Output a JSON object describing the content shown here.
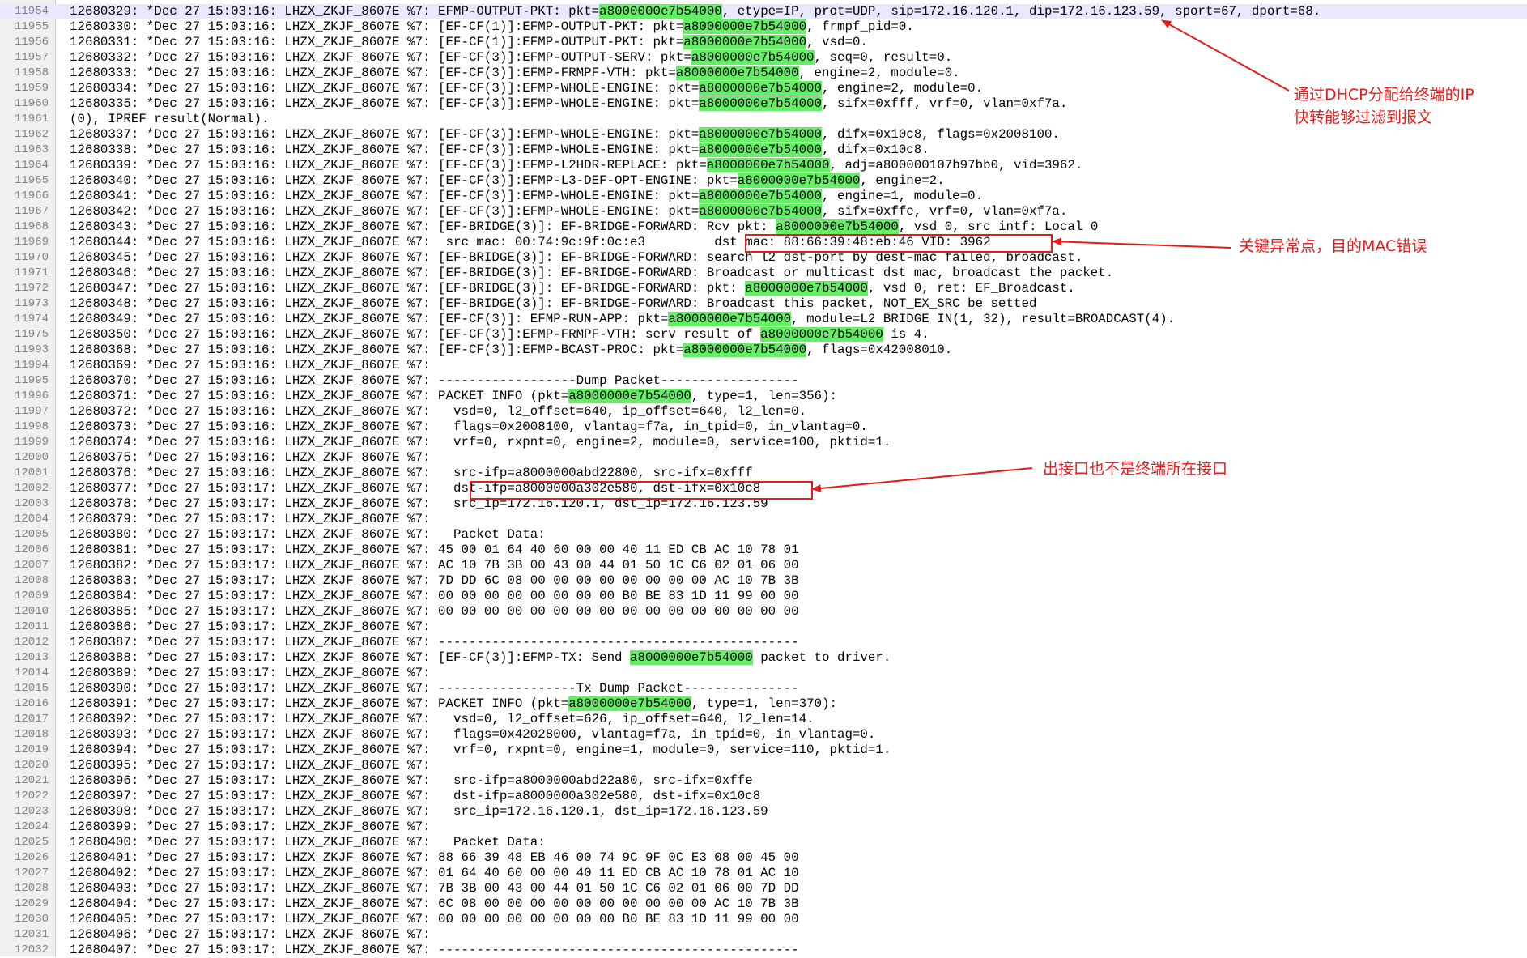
{
  "highlight_token": "a8000000e7b54000",
  "lines": [
    {
      "n": "11954",
      "t": "12680329: *Dec 27 15:03:16: LHZX_ZKJF_8607E %7: EFMP-OUTPUT-PKT: pkt=a8000000e7b54000, etype=IP, prot=UDP, sip=172.16.120.1, dip=172.16.123.59, sport=67, dport=68."
    },
    {
      "n": "11955",
      "t": "12680330: *Dec 27 15:03:16: LHZX_ZKJF_8607E %7: [EF-CF(1)]:EFMP-OUTPUT-PKT: pkt=a8000000e7b54000, frmpf_pid=0."
    },
    {
      "n": "11956",
      "t": "12680331: *Dec 27 15:03:16: LHZX_ZKJF_8607E %7: [EF-CF(1)]:EFMP-OUTPUT-PKT: pkt=a8000000e7b54000, vsd=0."
    },
    {
      "n": "11957",
      "t": "12680332: *Dec 27 15:03:16: LHZX_ZKJF_8607E %7: [EF-CF(3)]:EFMP-OUTPUT-SERV: pkt=a8000000e7b54000, seq=0, result=0."
    },
    {
      "n": "11958",
      "t": "12680333: *Dec 27 15:03:16: LHZX_ZKJF_8607E %7: [EF-CF(3)]:EFMP-FRMPF-VTH: pkt=a8000000e7b54000, engine=2, module=0."
    },
    {
      "n": "11959",
      "t": "12680334: *Dec 27 15:03:16: LHZX_ZKJF_8607E %7: [EF-CF(3)]:EFMP-WHOLE-ENGINE: pkt=a8000000e7b54000, engine=2, module=0."
    },
    {
      "n": "11960",
      "t": "12680335: *Dec 27 15:03:16: LHZX_ZKJF_8607E %7: [EF-CF(3)]:EFMP-WHOLE-ENGINE: pkt=a8000000e7b54000, sifx=0xfff, vrf=0, vlan=0xf7a."
    },
    {
      "n": "11961",
      "t": "(0), IPREF result(Normal)."
    },
    {
      "n": "11962",
      "t": "12680337: *Dec 27 15:03:16: LHZX_ZKJF_8607E %7: [EF-CF(3)]:EFMP-WHOLE-ENGINE: pkt=a8000000e7b54000, difx=0x10c8, flags=0x2008100."
    },
    {
      "n": "11963",
      "t": "12680338: *Dec 27 15:03:16: LHZX_ZKJF_8607E %7: [EF-CF(3)]:EFMP-WHOLE-ENGINE: pkt=a8000000e7b54000, difx=0x10c8."
    },
    {
      "n": "11964",
      "t": "12680339: *Dec 27 15:03:16: LHZX_ZKJF_8607E %7: [EF-CF(3)]:EFMP-L2HDR-REPLACE: pkt=a8000000e7b54000, adj=a800000107b97bb0, vid=3962."
    },
    {
      "n": "11965",
      "t": "12680340: *Dec 27 15:03:16: LHZX_ZKJF_8607E %7: [EF-CF(3)]:EFMP-L3-DEF-OPT-ENGINE: pkt=a8000000e7b54000, engine=2."
    },
    {
      "n": "11966",
      "t": "12680341: *Dec 27 15:03:16: LHZX_ZKJF_8607E %7: [EF-CF(3)]:EFMP-WHOLE-ENGINE: pkt=a8000000e7b54000, engine=1, module=0."
    },
    {
      "n": "11967",
      "t": "12680342: *Dec 27 15:03:16: LHZX_ZKJF_8607E %7: [EF-CF(3)]:EFMP-WHOLE-ENGINE: pkt=a8000000e7b54000, sifx=0xffe, vrf=0, vlan=0xf7a."
    },
    {
      "n": "11968",
      "t": "12680343: *Dec 27 15:03:16: LHZX_ZKJF_8607E %7: [EF-BRIDGE(3)]: EF-BRIDGE-FORWARD: Rcv pkt: a8000000e7b54000, vsd 0, src intf: Local 0"
    },
    {
      "n": "11969",
      "t": "12680344: *Dec 27 15:03:16: LHZX_ZKJF_8607E %7:  src mac: 00:74:9c:9f:0c:e3         dst mac: 88:66:39:48:eb:46 VID: 3962"
    },
    {
      "n": "11970",
      "t": "12680345: *Dec 27 15:03:16: LHZX_ZKJF_8607E %7: [EF-BRIDGE(3)]: EF-BRIDGE-FORWARD: search l2 dst-port by dest-mac failed, broadcast."
    },
    {
      "n": "11971",
      "t": "12680346: *Dec 27 15:03:16: LHZX_ZKJF_8607E %7: [EF-BRIDGE(3)]: EF-BRIDGE-FORWARD: Broadcast or multicast dst mac, broadcast the packet."
    },
    {
      "n": "11972",
      "t": "12680347: *Dec 27 15:03:16: LHZX_ZKJF_8607E %7: [EF-BRIDGE(3)]: EF-BRIDGE-FORWARD: pkt: a8000000e7b54000, vsd 0, ret: EF_Broadcast."
    },
    {
      "n": "11973",
      "t": "12680348: *Dec 27 15:03:16: LHZX_ZKJF_8607E %7: [EF-BRIDGE(3)]: EF-BRIDGE-FORWARD: Broadcast this packet, NOT_EX_SRC be setted"
    },
    {
      "n": "11974",
      "t": "12680349: *Dec 27 15:03:16: LHZX_ZKJF_8607E %7: [EF-CF(3)]: EFMP-RUN-APP: pkt=a8000000e7b54000, module=L2 BRIDGE IN(1, 32), result=BROADCAST(4)."
    },
    {
      "n": "11975",
      "t": "12680350: *Dec 27 15:03:16: LHZX_ZKJF_8607E %7: [EF-CF(3)]:EFMP-FRMPF-VTH: serv result of a8000000e7b54000 is 4."
    },
    {
      "n": "11993",
      "t": "12680368: *Dec 27 15:03:16: LHZX_ZKJF_8607E %7: [EF-CF(3)]:EFMP-BCAST-PROC: pkt=a8000000e7b54000, flags=0x42008010."
    },
    {
      "n": "11994",
      "t": "12680369: *Dec 27 15:03:16: LHZX_ZKJF_8607E %7:"
    },
    {
      "n": "11995",
      "t": "12680370: *Dec 27 15:03:16: LHZX_ZKJF_8607E %7: ------------------Dump Packet------------------"
    },
    {
      "n": "11996",
      "t": "12680371: *Dec 27 15:03:16: LHZX_ZKJF_8607E %7: PACKET INFO (pkt=a8000000e7b54000, type=1, len=356):"
    },
    {
      "n": "11997",
      "t": "12680372: *Dec 27 15:03:16: LHZX_ZKJF_8607E %7:   vsd=0, l2_offset=640, ip_offset=640, l2_len=0."
    },
    {
      "n": "11998",
      "t": "12680373: *Dec 27 15:03:16: LHZX_ZKJF_8607E %7:   flags=0x2008100, vlantag=f7a, in_tpid=0, in_vlantag=0."
    },
    {
      "n": "11999",
      "t": "12680374: *Dec 27 15:03:16: LHZX_ZKJF_8607E %7:   vrf=0, rxpnt=0, engine=2, module=0, service=100, pktid=1."
    },
    {
      "n": "12000",
      "t": "12680375: *Dec 27 15:03:16: LHZX_ZKJF_8607E %7:"
    },
    {
      "n": "12001",
      "t": "12680376: *Dec 27 15:03:16: LHZX_ZKJF_8607E %7:   src-ifp=a8000000abd22800, src-ifx=0xfff"
    },
    {
      "n": "12002",
      "t": "12680377: *Dec 27 15:03:17: LHZX_ZKJF_8607E %7:   dst-ifp=a8000000a302e580, dst-ifx=0x10c8"
    },
    {
      "n": "12003",
      "t": "12680378: *Dec 27 15:03:17: LHZX_ZKJF_8607E %7:   src_ip=172.16.120.1, dst_ip=172.16.123.59"
    },
    {
      "n": "12004",
      "t": "12680379: *Dec 27 15:03:17: LHZX_ZKJF_8607E %7:"
    },
    {
      "n": "12005",
      "t": "12680380: *Dec 27 15:03:17: LHZX_ZKJF_8607E %7:   Packet Data:"
    },
    {
      "n": "12006",
      "t": "12680381: *Dec 27 15:03:17: LHZX_ZKJF_8607E %7: 45 00 01 64 40 60 00 00 40 11 ED CB AC 10 78 01"
    },
    {
      "n": "12007",
      "t": "12680382: *Dec 27 15:03:17: LHZX_ZKJF_8607E %7: AC 10 7B 3B 00 43 00 44 01 50 1C C6 02 01 06 00"
    },
    {
      "n": "12008",
      "t": "12680383: *Dec 27 15:03:17: LHZX_ZKJF_8607E %7: 7D DD 6C 08 00 00 00 00 00 00 00 00 AC 10 7B 3B"
    },
    {
      "n": "12009",
      "t": "12680384: *Dec 27 15:03:17: LHZX_ZKJF_8607E %7: 00 00 00 00 00 00 00 00 B0 BE 83 1D 11 99 00 00"
    },
    {
      "n": "12010",
      "t": "12680385: *Dec 27 15:03:17: LHZX_ZKJF_8607E %7: 00 00 00 00 00 00 00 00 00 00 00 00 00 00 00 00"
    },
    {
      "n": "12011",
      "t": "12680386: *Dec 27 15:03:17: LHZX_ZKJF_8607E %7:"
    },
    {
      "n": "12012",
      "t": "12680387: *Dec 27 15:03:17: LHZX_ZKJF_8607E %7: -----------------------------------------------"
    },
    {
      "n": "12013",
      "t": "12680388: *Dec 27 15:03:17: LHZX_ZKJF_8607E %7: [EF-CF(3)]:EFMP-TX: Send a8000000e7b54000 packet to driver."
    },
    {
      "n": "12014",
      "t": "12680389: *Dec 27 15:03:17: LHZX_ZKJF_8607E %7:"
    },
    {
      "n": "12015",
      "t": "12680390: *Dec 27 15:03:17: LHZX_ZKJF_8607E %7: ------------------Tx Dump Packet---------------"
    },
    {
      "n": "12016",
      "t": "12680391: *Dec 27 15:03:17: LHZX_ZKJF_8607E %7: PACKET INFO (pkt=a8000000e7b54000, type=1, len=370):"
    },
    {
      "n": "12017",
      "t": "12680392: *Dec 27 15:03:17: LHZX_ZKJF_8607E %7:   vsd=0, l2_offset=626, ip_offset=640, l2_len=14."
    },
    {
      "n": "12018",
      "t": "12680393: *Dec 27 15:03:17: LHZX_ZKJF_8607E %7:   flags=0x42028000, vlantag=f7a, in_tpid=0, in_vlantag=0."
    },
    {
      "n": "12019",
      "t": "12680394: *Dec 27 15:03:17: LHZX_ZKJF_8607E %7:   vrf=0, rxpnt=0, engine=1, module=0, service=110, pktid=1."
    },
    {
      "n": "12020",
      "t": "12680395: *Dec 27 15:03:17: LHZX_ZKJF_8607E %7:"
    },
    {
      "n": "12021",
      "t": "12680396: *Dec 27 15:03:17: LHZX_ZKJF_8607E %7:   src-ifp=a8000000abd22a80, src-ifx=0xffe"
    },
    {
      "n": "12022",
      "t": "12680397: *Dec 27 15:03:17: LHZX_ZKJF_8607E %7:   dst-ifp=a8000000a302e580, dst-ifx=0x10c8"
    },
    {
      "n": "12023",
      "t": "12680398: *Dec 27 15:03:17: LHZX_ZKJF_8607E %7:   src_ip=172.16.120.1, dst_ip=172.16.123.59"
    },
    {
      "n": "12024",
      "t": "12680399: *Dec 27 15:03:17: LHZX_ZKJF_8607E %7:"
    },
    {
      "n": "12025",
      "t": "12680400: *Dec 27 15:03:17: LHZX_ZKJF_8607E %7:   Packet Data:"
    },
    {
      "n": "12026",
      "t": "12680401: *Dec 27 15:03:17: LHZX_ZKJF_8607E %7: 88 66 39 48 EB 46 00 74 9C 9F 0C E3 08 00 45 00"
    },
    {
      "n": "12027",
      "t": "12680402: *Dec 27 15:03:17: LHZX_ZKJF_8607E %7: 01 64 40 60 00 00 40 11 ED CB AC 10 78 01 AC 10"
    },
    {
      "n": "12028",
      "t": "12680403: *Dec 27 15:03:17: LHZX_ZKJF_8607E %7: 7B 3B 00 43 00 44 01 50 1C C6 02 01 06 00 7D DD"
    },
    {
      "n": "12029",
      "t": "12680404: *Dec 27 15:03:17: LHZX_ZKJF_8607E %7: 6C 08 00 00 00 00 00 00 00 00 00 00 AC 10 7B 3B"
    },
    {
      "n": "12030",
      "t": "12680405: *Dec 27 15:03:17: LHZX_ZKJF_8607E %7: 00 00 00 00 00 00 00 00 B0 BE 83 1D 11 99 00 00"
    },
    {
      "n": "12031",
      "t": "12680406: *Dec 27 15:03:17: LHZX_ZKJF_8607E %7:"
    },
    {
      "n": "12032",
      "t": "12680407: *Dec 27 15:03:17: LHZX_ZKJF_8607E %7: -----------------------------------------------"
    }
  ],
  "annotations": {
    "dhcp_note_line1": "通过DHCP分配给终端的IP",
    "dhcp_note_line2": "快转能够过滤到报文",
    "mac_note": "关键异常点，目的MAC错误",
    "intf_note": "出接口也不是终端所在接口"
  },
  "colors": {
    "annotation": "#e31c1c",
    "highlight": "#66ee66",
    "gutter": "#f0f0f0"
  }
}
